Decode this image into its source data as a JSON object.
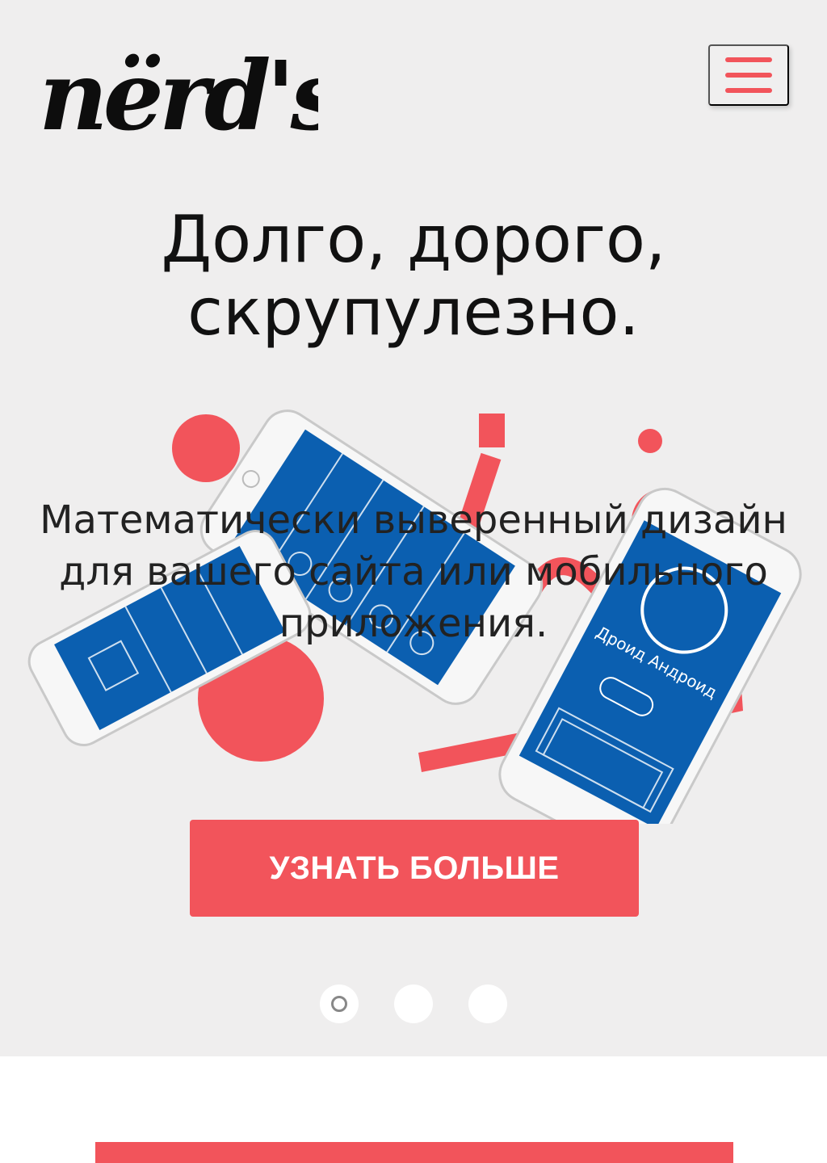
{
  "header": {
    "logo_text": "nërd's",
    "menu_icon": "hamburger-icon"
  },
  "hero": {
    "title_line1": "Долго, дорого,",
    "title_line2": "скрупулезно.",
    "subtitle": "Математически выверенный дизайн для вашего сайта или мобильного приложения.",
    "cta_label": "УЗНАТЬ БОЛЬШЕ",
    "slider": {
      "count": 3,
      "active": 1
    },
    "phone_screen_text": "Дроид Андроид"
  },
  "colors": {
    "accent": "#f2545b",
    "hero_bg": "#efeeee",
    "phone_screen": "#0b5fb0"
  }
}
